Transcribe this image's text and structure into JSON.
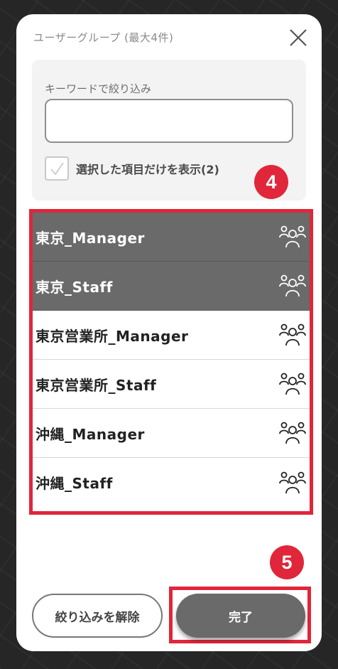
{
  "modal": {
    "title": "ユーザーグループ (最大4件)"
  },
  "filter": {
    "label": "キーワードで絞り込み",
    "input_value": "",
    "input_placeholder": "",
    "show_selected_label": "選択した項目だけを表示(2)",
    "show_selected_checked": false
  },
  "groups": [
    {
      "label": "東京_Manager",
      "selected": true
    },
    {
      "label": "東京_Staff",
      "selected": true
    },
    {
      "label": "東京営業所_Manager",
      "selected": false
    },
    {
      "label": "東京営業所_Staff",
      "selected": false
    },
    {
      "label": "沖縄_Manager",
      "selected": false
    },
    {
      "label": "沖縄_Staff",
      "selected": false
    }
  ],
  "annotations": {
    "badge_list": "4",
    "badge_done": "5",
    "highlight_color": "#e0263a"
  },
  "footer": {
    "clear_label": "絞り込みを解除",
    "done_label": "完了"
  },
  "icons": {
    "close": "close-icon",
    "check": "checkmark-icon",
    "group": "user-group-icon"
  }
}
